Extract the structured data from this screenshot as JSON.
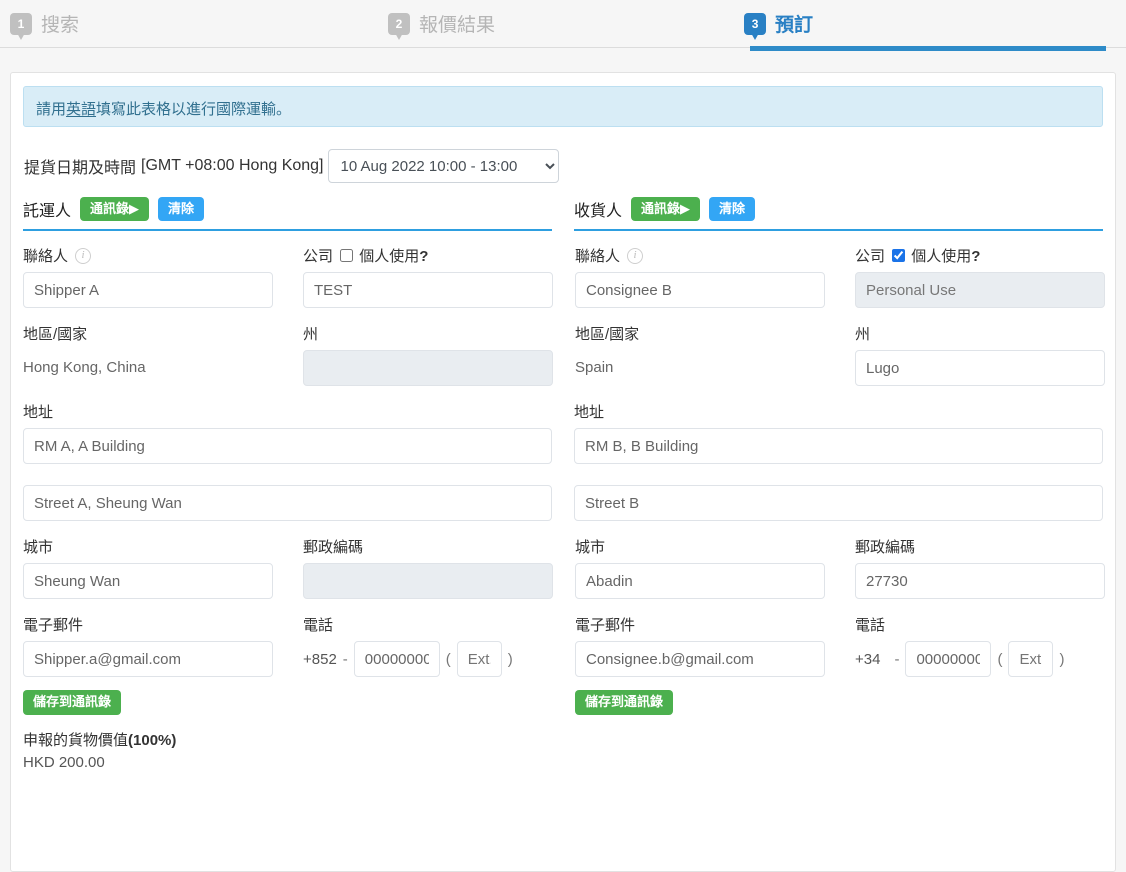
{
  "steps": [
    {
      "number": "1",
      "label": "搜索",
      "active": false
    },
    {
      "number": "2",
      "label": "報價結果",
      "active": false
    },
    {
      "number": "3",
      "label": "預訂",
      "active": true
    }
  ],
  "notice": {
    "prefix": "請用",
    "link": "英語",
    "suffix": "填寫此表格以進行國際運輸。"
  },
  "pickup": {
    "label": "提貨日期及時間",
    "timezone": "[GMT +08:00 Hong Kong]",
    "selected": "10 Aug 2022 10:00 - 13:00",
    "options": [
      "10 Aug 2022 10:00 - 13:00"
    ]
  },
  "buttons": {
    "address_book": "通訊錄",
    "address_book_arrow": "▶",
    "clear": "清除",
    "save_to_address_book": "儲存到通訊錄"
  },
  "labels": {
    "contact": "聯絡人",
    "company": "公司",
    "personal_use": "個人使用",
    "personal_use_mark": "?",
    "region_country": "地區/國家",
    "state": "州",
    "address": "地址",
    "city": "城市",
    "postal_code": "郵政編碼",
    "email": "電子郵件",
    "phone": "電話",
    "ext_placeholder": "Ext."
  },
  "shipper": {
    "title": "託運人",
    "contact": "Shipper A",
    "company": "TEST",
    "personal_use_checked": false,
    "company_disabled": false,
    "region_country": "Hong Kong, China",
    "state": "",
    "state_disabled": true,
    "address1": "RM A, A Building",
    "address2": "Street A, Sheung Wan",
    "city": "Sheung Wan",
    "postal_code": "",
    "postal_disabled": true,
    "email": "Shipper.a@gmail.com",
    "country_code": "+852",
    "phone": "00000000",
    "ext": ""
  },
  "consignee": {
    "title": "收貨人",
    "contact": "Consignee B",
    "company": "Personal Use",
    "personal_use_checked": true,
    "company_disabled": true,
    "region_country": "Spain",
    "state": "Lugo",
    "state_disabled": false,
    "address1": "RM B, B Building",
    "address2": "Street B",
    "city": "Abadin",
    "postal_code": "27730",
    "postal_disabled": false,
    "email": "Consignee.b@gmail.com",
    "country_code": "+34",
    "phone": "00000000",
    "ext": ""
  },
  "declared": {
    "label_text": "申報的貨物價值",
    "label_percent": "(100%)",
    "value": "HKD 200.00"
  },
  "colors": {
    "accent_blue": "#2e8bc8",
    "green_button": "#4cb04e",
    "blue_button": "#33a6f5",
    "notice_bg": "#d9edf7",
    "notice_text": "#31708f"
  }
}
